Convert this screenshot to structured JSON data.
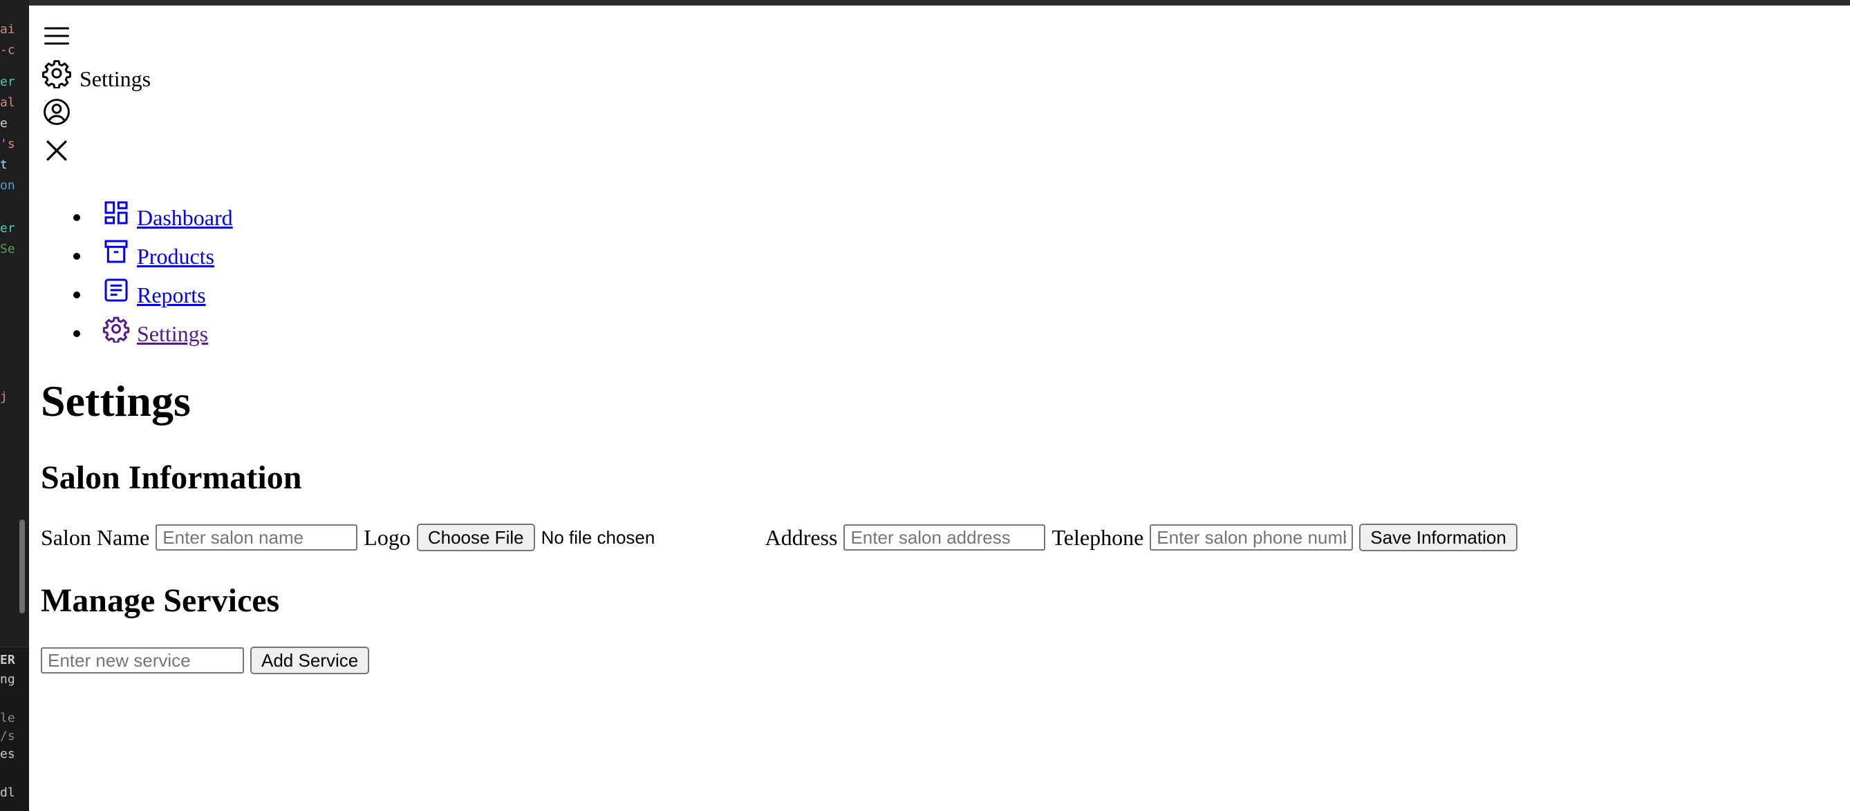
{
  "editor": {
    "snippets": [
      "ai",
      "-c",
      "er",
      "al",
      "e",
      "'s",
      "t",
      "on",
      "er",
      "Se",
      "j",
      "^",
      "ER",
      "ng",
      "le",
      "/s",
      "es",
      "dl"
    ]
  },
  "header": {
    "menu_icon": "hamburger-menu-icon",
    "settings_icon": "gear-icon",
    "title": "Settings",
    "profile_icon": "user-circle-icon",
    "close_icon": "close-icon"
  },
  "nav": {
    "items": [
      {
        "label": "Dashboard",
        "icon": "dashboard-icon"
      },
      {
        "label": "Products",
        "icon": "archive-box-icon"
      },
      {
        "label": "Reports",
        "icon": "document-icon"
      },
      {
        "label": "Settings",
        "icon": "gear-icon"
      }
    ]
  },
  "main": {
    "title": "Settings",
    "salon_section": {
      "heading": "Salon Information",
      "name_label": "Salon Name",
      "name_placeholder": "Enter salon name",
      "logo_label": "Logo",
      "choose_file_label": "Choose File",
      "file_status": "No file chosen",
      "address_label": "Address",
      "address_placeholder": "Enter salon address",
      "telephone_label": "Telephone",
      "telephone_placeholder": "Enter salon phone number",
      "save_label": "Save Information"
    },
    "services_section": {
      "heading": "Manage Services",
      "service_placeholder": "Enter new service",
      "add_label": "Add Service"
    }
  },
  "colors": {
    "link": "#0000ee",
    "visited_link": "#551a8b",
    "editor_bg": "#1e1e1e"
  }
}
